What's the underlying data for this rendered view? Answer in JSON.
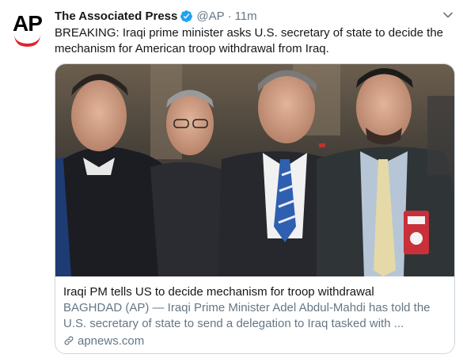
{
  "tweet": {
    "author_name": "The Associated Press",
    "handle": "@AP",
    "separator": "·",
    "time": "11m",
    "avatar_text": "AP",
    "text": "BREAKING: Iraqi prime minister asks U.S. secretary of state to decide the mechanism for American troop withdrawal from Iraq.",
    "verified_icon": "verified-badge-icon",
    "menu_icon": "chevron-down-icon"
  },
  "card": {
    "title": "Iraqi PM tells US to decide mechanism for troop withdrawal",
    "description": "BAGHDAD (AP) — Iraqi Prime Minister Adel Abdul-Mahdi has told the U.S. secretary of state to send a delegation to Iraq tasked with ...",
    "domain": "apnews.com",
    "link_icon": "link-icon"
  },
  "colors": {
    "text_primary": "#14171a",
    "text_secondary": "#657786",
    "verified_blue": "#1da1f2",
    "brand_red": "#e0242f",
    "border": "#ccd6dd"
  }
}
